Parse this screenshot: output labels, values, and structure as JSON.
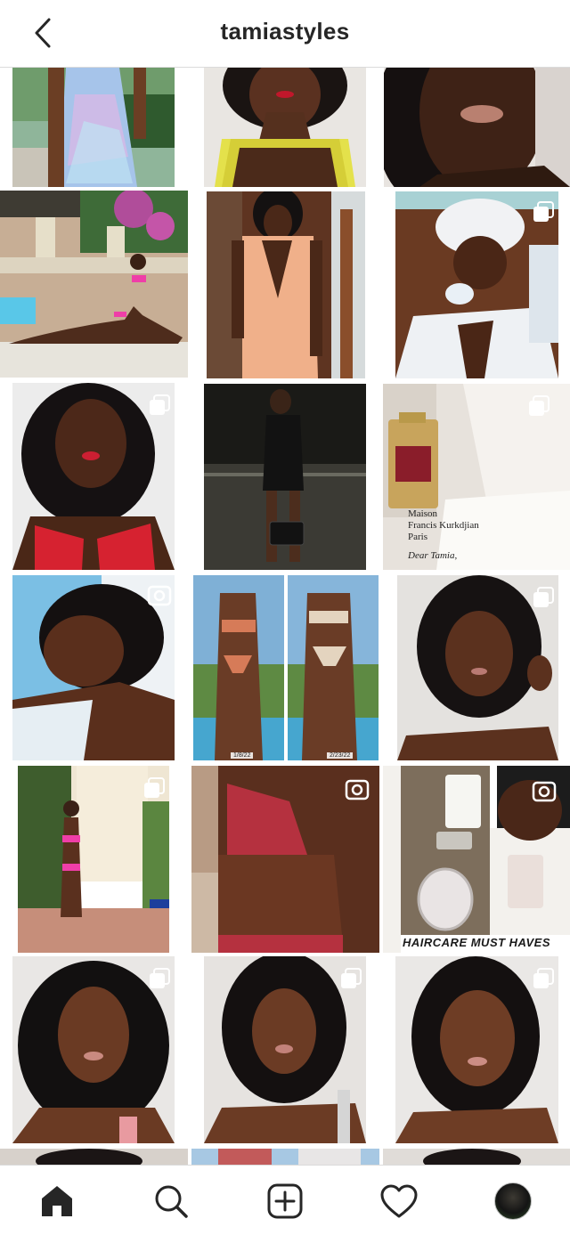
{
  "header": {
    "username": "tamiastyles",
    "back_icon": "chevron-left-icon"
  },
  "grid": {
    "tiles": [
      {
        "badge": ""
      },
      {
        "badge": ""
      },
      {
        "badge": ""
      },
      {
        "badge": ""
      },
      {
        "badge": ""
      },
      {
        "badge": "carousel"
      },
      {
        "badge": "carousel"
      },
      {
        "badge": ""
      },
      {
        "badge": "carousel"
      },
      {
        "badge": "igtv"
      },
      {
        "badge": ""
      },
      {
        "badge": "carousel"
      },
      {
        "badge": "carousel"
      },
      {
        "badge": "igtv"
      },
      {
        "badge": "igtv"
      },
      {
        "badge": "carousel"
      },
      {
        "badge": "carousel"
      },
      {
        "badge": "carousel"
      }
    ],
    "photo_texts": {
      "letter_lines": [
        "Maison",
        "Francis Kurkdjian",
        "Paris",
        "Dear Tamia,"
      ],
      "before_date": "1/8/22",
      "after_date": "2/23/22",
      "haircare_caption": "HAIRCARE MUST HAVES"
    }
  },
  "bottom_nav": {
    "items": [
      "home-icon",
      "search-icon",
      "new-post-icon",
      "activity-icon",
      "profile-avatar"
    ]
  },
  "colors": {
    "header_text": "#262626",
    "divider": "#dbdbdb",
    "background": "#ffffff"
  }
}
